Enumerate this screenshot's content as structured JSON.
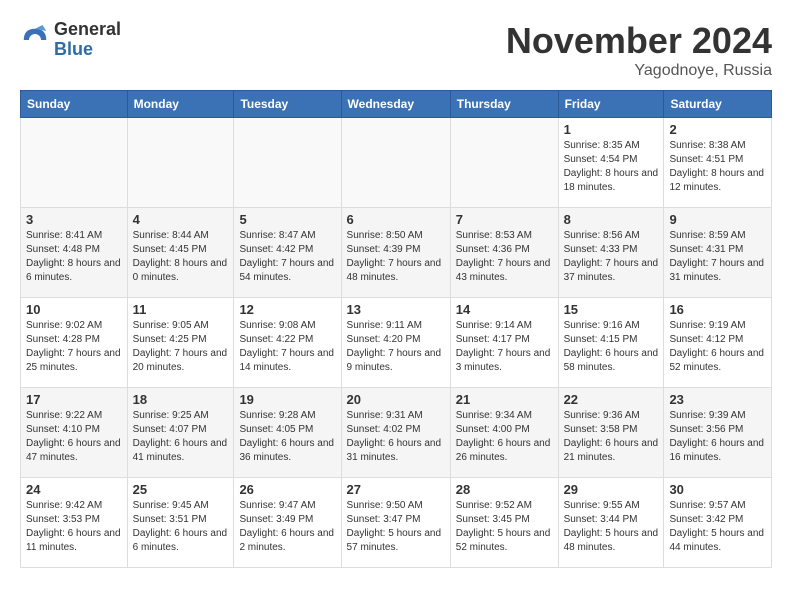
{
  "logo": {
    "line1": "General",
    "line2": "Blue"
  },
  "header": {
    "month": "November 2024",
    "location": "Yagodnoye, Russia"
  },
  "weekdays": [
    "Sunday",
    "Monday",
    "Tuesday",
    "Wednesday",
    "Thursday",
    "Friday",
    "Saturday"
  ],
  "weeks": [
    [
      {
        "day": "",
        "sunrise": "",
        "sunset": "",
        "daylight": ""
      },
      {
        "day": "",
        "sunrise": "",
        "sunset": "",
        "daylight": ""
      },
      {
        "day": "",
        "sunrise": "",
        "sunset": "",
        "daylight": ""
      },
      {
        "day": "",
        "sunrise": "",
        "sunset": "",
        "daylight": ""
      },
      {
        "day": "",
        "sunrise": "",
        "sunset": "",
        "daylight": ""
      },
      {
        "day": "1",
        "sunrise": "Sunrise: 8:35 AM",
        "sunset": "Sunset: 4:54 PM",
        "daylight": "Daylight: 8 hours and 18 minutes."
      },
      {
        "day": "2",
        "sunrise": "Sunrise: 8:38 AM",
        "sunset": "Sunset: 4:51 PM",
        "daylight": "Daylight: 8 hours and 12 minutes."
      }
    ],
    [
      {
        "day": "3",
        "sunrise": "Sunrise: 8:41 AM",
        "sunset": "Sunset: 4:48 PM",
        "daylight": "Daylight: 8 hours and 6 minutes."
      },
      {
        "day": "4",
        "sunrise": "Sunrise: 8:44 AM",
        "sunset": "Sunset: 4:45 PM",
        "daylight": "Daylight: 8 hours and 0 minutes."
      },
      {
        "day": "5",
        "sunrise": "Sunrise: 8:47 AM",
        "sunset": "Sunset: 4:42 PM",
        "daylight": "Daylight: 7 hours and 54 minutes."
      },
      {
        "day": "6",
        "sunrise": "Sunrise: 8:50 AM",
        "sunset": "Sunset: 4:39 PM",
        "daylight": "Daylight: 7 hours and 48 minutes."
      },
      {
        "day": "7",
        "sunrise": "Sunrise: 8:53 AM",
        "sunset": "Sunset: 4:36 PM",
        "daylight": "Daylight: 7 hours and 43 minutes."
      },
      {
        "day": "8",
        "sunrise": "Sunrise: 8:56 AM",
        "sunset": "Sunset: 4:33 PM",
        "daylight": "Daylight: 7 hours and 37 minutes."
      },
      {
        "day": "9",
        "sunrise": "Sunrise: 8:59 AM",
        "sunset": "Sunset: 4:31 PM",
        "daylight": "Daylight: 7 hours and 31 minutes."
      }
    ],
    [
      {
        "day": "10",
        "sunrise": "Sunrise: 9:02 AM",
        "sunset": "Sunset: 4:28 PM",
        "daylight": "Daylight: 7 hours and 25 minutes."
      },
      {
        "day": "11",
        "sunrise": "Sunrise: 9:05 AM",
        "sunset": "Sunset: 4:25 PM",
        "daylight": "Daylight: 7 hours and 20 minutes."
      },
      {
        "day": "12",
        "sunrise": "Sunrise: 9:08 AM",
        "sunset": "Sunset: 4:22 PM",
        "daylight": "Daylight: 7 hours and 14 minutes."
      },
      {
        "day": "13",
        "sunrise": "Sunrise: 9:11 AM",
        "sunset": "Sunset: 4:20 PM",
        "daylight": "Daylight: 7 hours and 9 minutes."
      },
      {
        "day": "14",
        "sunrise": "Sunrise: 9:14 AM",
        "sunset": "Sunset: 4:17 PM",
        "daylight": "Daylight: 7 hours and 3 minutes."
      },
      {
        "day": "15",
        "sunrise": "Sunrise: 9:16 AM",
        "sunset": "Sunset: 4:15 PM",
        "daylight": "Daylight: 6 hours and 58 minutes."
      },
      {
        "day": "16",
        "sunrise": "Sunrise: 9:19 AM",
        "sunset": "Sunset: 4:12 PM",
        "daylight": "Daylight: 6 hours and 52 minutes."
      }
    ],
    [
      {
        "day": "17",
        "sunrise": "Sunrise: 9:22 AM",
        "sunset": "Sunset: 4:10 PM",
        "daylight": "Daylight: 6 hours and 47 minutes."
      },
      {
        "day": "18",
        "sunrise": "Sunrise: 9:25 AM",
        "sunset": "Sunset: 4:07 PM",
        "daylight": "Daylight: 6 hours and 41 minutes."
      },
      {
        "day": "19",
        "sunrise": "Sunrise: 9:28 AM",
        "sunset": "Sunset: 4:05 PM",
        "daylight": "Daylight: 6 hours and 36 minutes."
      },
      {
        "day": "20",
        "sunrise": "Sunrise: 9:31 AM",
        "sunset": "Sunset: 4:02 PM",
        "daylight": "Daylight: 6 hours and 31 minutes."
      },
      {
        "day": "21",
        "sunrise": "Sunrise: 9:34 AM",
        "sunset": "Sunset: 4:00 PM",
        "daylight": "Daylight: 6 hours and 26 minutes."
      },
      {
        "day": "22",
        "sunrise": "Sunrise: 9:36 AM",
        "sunset": "Sunset: 3:58 PM",
        "daylight": "Daylight: 6 hours and 21 minutes."
      },
      {
        "day": "23",
        "sunrise": "Sunrise: 9:39 AM",
        "sunset": "Sunset: 3:56 PM",
        "daylight": "Daylight: 6 hours and 16 minutes."
      }
    ],
    [
      {
        "day": "24",
        "sunrise": "Sunrise: 9:42 AM",
        "sunset": "Sunset: 3:53 PM",
        "daylight": "Daylight: 6 hours and 11 minutes."
      },
      {
        "day": "25",
        "sunrise": "Sunrise: 9:45 AM",
        "sunset": "Sunset: 3:51 PM",
        "daylight": "Daylight: 6 hours and 6 minutes."
      },
      {
        "day": "26",
        "sunrise": "Sunrise: 9:47 AM",
        "sunset": "Sunset: 3:49 PM",
        "daylight": "Daylight: 6 hours and 2 minutes."
      },
      {
        "day": "27",
        "sunrise": "Sunrise: 9:50 AM",
        "sunset": "Sunset: 3:47 PM",
        "daylight": "Daylight: 5 hours and 57 minutes."
      },
      {
        "day": "28",
        "sunrise": "Sunrise: 9:52 AM",
        "sunset": "Sunset: 3:45 PM",
        "daylight": "Daylight: 5 hours and 52 minutes."
      },
      {
        "day": "29",
        "sunrise": "Sunrise: 9:55 AM",
        "sunset": "Sunset: 3:44 PM",
        "daylight": "Daylight: 5 hours and 48 minutes."
      },
      {
        "day": "30",
        "sunrise": "Sunrise: 9:57 AM",
        "sunset": "Sunset: 3:42 PM",
        "daylight": "Daylight: 5 hours and 44 minutes."
      }
    ]
  ]
}
